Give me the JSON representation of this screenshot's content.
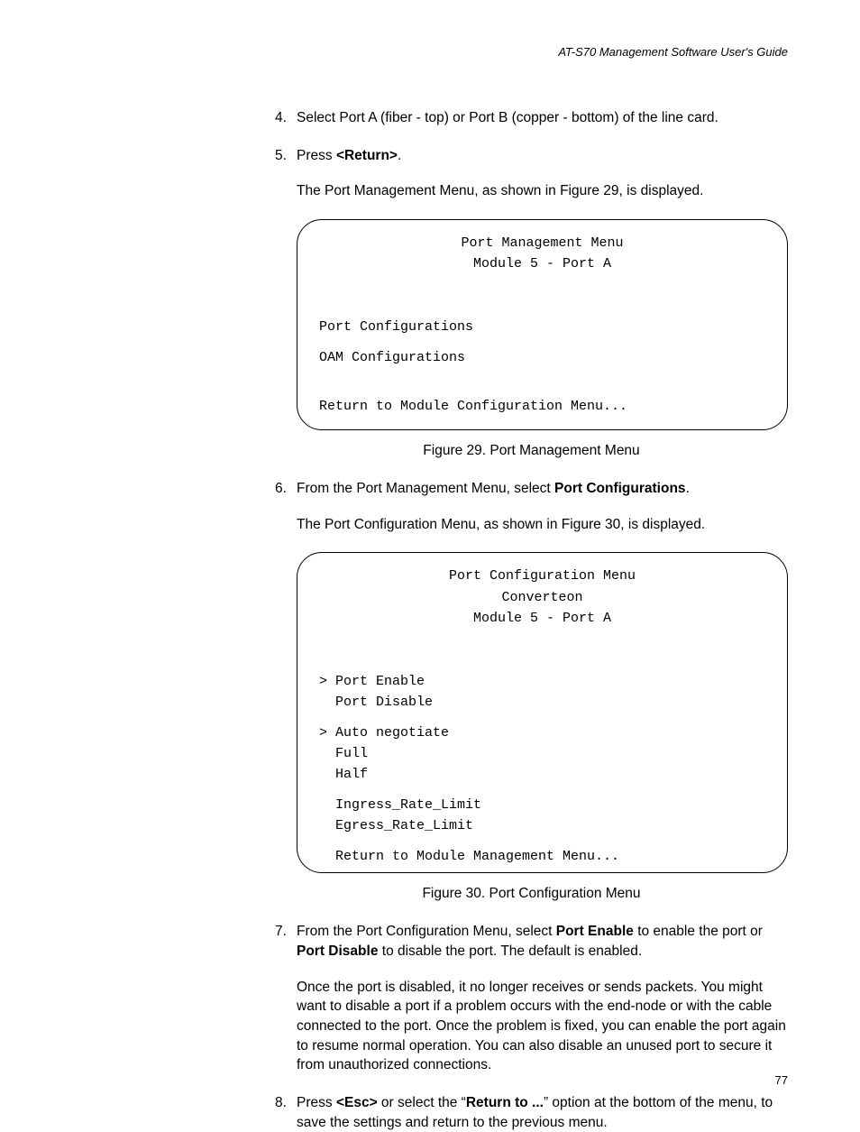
{
  "header": "AT-S70 Management Software User's Guide",
  "steps": {
    "s4": {
      "num": "4.",
      "text": "Select Port A (fiber - top) or Port B (copper - bottom) of the line card."
    },
    "s5": {
      "num": "5.",
      "press": "Press ",
      "return_bold": "<Return>",
      "period": ".",
      "desc": "The Port Management Menu, as shown in Figure 29, is displayed."
    },
    "s6": {
      "num": "6.",
      "pre": "From the Port Management Menu, select ",
      "bold": "Port Configurations",
      "post": ".",
      "desc": "The Port Configuration Menu, as shown in Figure 30, is displayed."
    },
    "s7": {
      "num": "7.",
      "pre": "From the Port Configuration Menu, select ",
      "bold1": "Port Enable",
      "mid1": " to enable the port or ",
      "bold2": "Port Disable",
      "mid2": " to disable the port. The default is enabled.",
      "desc": "Once the port is disabled, it no longer receives or sends packets. You might want to disable a port if a problem occurs with the end-node or with the cable connected to the port. Once the problem is fixed, you can enable the port again to resume normal operation. You can also disable an unused port to secure it from unauthorized connections."
    },
    "s8": {
      "num": "8.",
      "pre": "Press ",
      "bold1": "<Esc>",
      "mid1": " or select the “",
      "bold2": "Return to ...",
      "mid2": "” option at the bottom of the menu, to save the settings and return to the previous menu."
    }
  },
  "figure29": {
    "title": "Port Management Menu",
    "subtitle": "Module 5 - Port A",
    "line1": "Port Configurations",
    "line2": "OAM Configurations",
    "line3": "Return to Module Configuration Menu...",
    "caption": "Figure 29. Port Management Menu"
  },
  "figure30": {
    "title": "Port Configuration Menu",
    "subtitle1": "Converteon",
    "subtitle2": "Module 5 - Port A",
    "l1": "> Port Enable",
    "l2": "  Port Disable",
    "l3": "> Auto negotiate",
    "l4": "  Full",
    "l5": "  Half",
    "l6": "  Ingress_Rate_Limit",
    "l7": "  Egress_Rate_Limit",
    "l8": "  Return to Module Management Menu...",
    "caption": "Figure 30. Port Configuration Menu"
  },
  "pagenum": "77"
}
